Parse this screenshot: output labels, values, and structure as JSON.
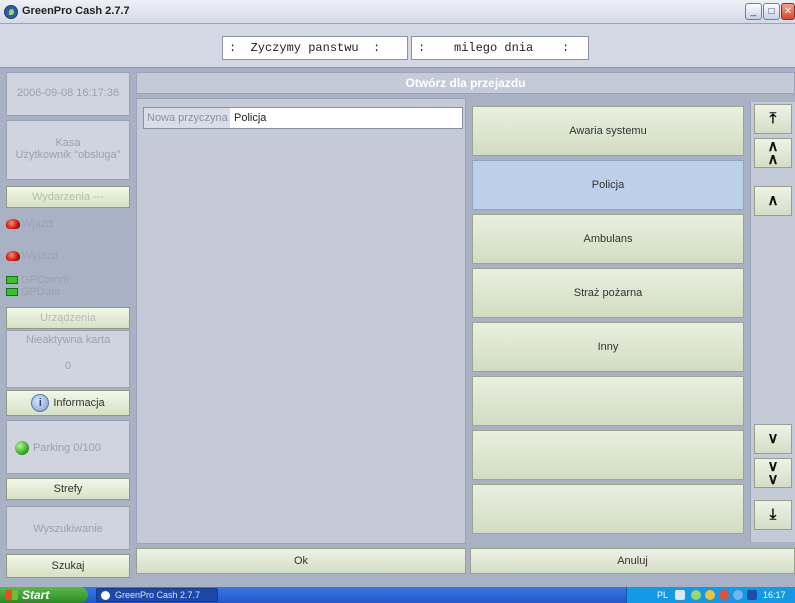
{
  "window": {
    "title": "GreenPro Cash 2.7.7",
    "minimize": "_",
    "maximize": "□",
    "close": "✕"
  },
  "marquee": {
    "left": ":  Zyczymy panstwu  :",
    "right": ":    milego dnia    :"
  },
  "sidebar": {
    "datetime": "2006-09-08 16:17:36",
    "station": "Kasa",
    "user": "Użytkownik \"obsluga\"",
    "events_button": "Wydarzenia ---",
    "entry": "Wjazd",
    "exit": "Wyjazd",
    "device1": "GPComm",
    "device2": "GPData",
    "devices_button": "Urządzenia",
    "card_label": "Nieaktywna karta",
    "card_count": "0",
    "info_button": "Informacja",
    "parking": "Parking 0/100",
    "zones_button": "Strefy",
    "search_label": "Wyszukiwanie",
    "search_button": "Szukaj"
  },
  "main": {
    "title": "Otwórz dla przejazdu",
    "reason_label": "Nowa przyczyna",
    "reason_value": "Policja",
    "reasons": [
      "Awaria systemu",
      "Policja",
      "Ambulans",
      "Straż pożarna",
      "Inny",
      "",
      "",
      ""
    ],
    "selected_index": 1,
    "ok": "Ok",
    "cancel": "Anuluj"
  },
  "scroll_icons": [
    "scroll-top-icon",
    "page-up-icon",
    "line-up-icon",
    "line-down-icon",
    "page-down-icon",
    "scroll-bottom-icon"
  ],
  "taskbar": {
    "start": "Start",
    "app": "GreenPro Cash 2.7.7",
    "lang": "PL",
    "clock": "16:17"
  },
  "colors": {
    "selected": "#bcd0ea",
    "button": "#d6e1c5",
    "panel": "#c4cad8"
  }
}
